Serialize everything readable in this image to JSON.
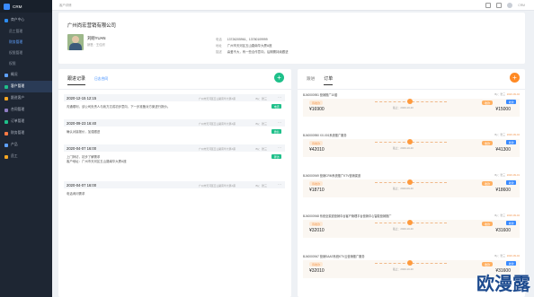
{
  "app": {
    "title": "CRM"
  },
  "sidebar": {
    "items": [
      {
        "label": "商户中心",
        "level": "main",
        "color": "#2d8cf0"
      },
      {
        "label": "员工管理",
        "level": "sub"
      },
      {
        "label": "财务管理",
        "level": "sub",
        "active_sub": true
      },
      {
        "label": "权限管理",
        "level": "sub"
      },
      {
        "label": "权限",
        "level": "sub"
      },
      {
        "label": "概况",
        "level": "main",
        "color": "#5fa1ff"
      },
      {
        "label": "客户管理",
        "level": "main",
        "color": "#1fc08a",
        "active": true
      },
      {
        "label": "跟进客户",
        "level": "main",
        "color": "#f5a623"
      },
      {
        "label": "合同管理",
        "level": "main",
        "color": "#8e7cc3"
      },
      {
        "label": "订单管理",
        "level": "main",
        "color": "#1fc08a"
      },
      {
        "label": "财务管理",
        "level": "main",
        "color": "#ff7a45"
      },
      {
        "label": "产品",
        "level": "main",
        "color": "#5fa1ff"
      },
      {
        "label": "员工",
        "level": "main",
        "color": "#f5a623"
      }
    ]
  },
  "topbar": {
    "breadcrumb": "客户详情",
    "user": "CRM"
  },
  "company": {
    "name": "广州尚宏营销有限公司",
    "person_name": "刘刚YUAN",
    "person_meta": "销售 · 王佳欣",
    "fields": [
      {
        "k": "电话",
        "v": "13726205961、13780109999"
      },
      {
        "k": "地址",
        "v": "广州市天河区五山路南华大厦A座"
      },
      {
        "k": "描述",
        "v": "喜爱不大，有一些合作意向，后期需持续跟进"
      }
    ]
  },
  "follow": {
    "tabs": [
      "跟进记录",
      "日志合同"
    ],
    "records": [
      {
        "time": "2020-12-15  12:15",
        "loc": "广州市天河区五山路南华大厦A座",
        "by": "By：张三",
        "text": "沟通顺利，该公司负责人与我方达成初步意向，下一步准备对方案进行报价。",
        "badge": "电话"
      },
      {
        "time": "2020-09-23  16:40",
        "loc": "广州市天河区五山路南华大厦A座",
        "by": "By：张三",
        "text": "确认对接报价，加强跟进",
        "badge": "微信"
      },
      {
        "time": "2020-04-07  16:00",
        "loc": "广州市天河区五山路南华大厦A座",
        "by": "By：张三",
        "text": "上门拜访，初步了解需求\n客户地址：广州市天河区五山路南华大厦A座",
        "badge": "拜访"
      },
      {
        "time": "2020-04-07  16:00",
        "loc": "广州市天河区五山路南华大厦A座",
        "by": "By：张三",
        "text": "电话询问需求",
        "badge": ""
      }
    ]
  },
  "orders": {
    "tabs": [
      "跟进",
      "订单"
    ],
    "rows": [
      {
        "no": "BJ40000951 营销推广10套",
        "by": "By：张三",
        "date": "2020-09-02",
        "pay_tag": "待收款",
        "price1": "¥16900",
        "cutoff": "截止：2020-10-20",
        "right_tag": "收款",
        "price2": "¥15000",
        "btn": "收款"
      },
      {
        "no": "BJ40000950 XX-001系统推广服务",
        "by": "By：张三",
        "date": "2020-09-02",
        "pay_tag": "待收款",
        "price1": "¥42010",
        "cutoff": "截止：2020-10-20",
        "right_tag": "收款",
        "price2": "¥41300",
        "btn": "收款"
      },
      {
        "no": "BJ40000949 营销CRM系统推广KTV营销渠道",
        "by": "By：张三",
        "date": "2020-09-01",
        "pay_tag": "待收款",
        "price1": "¥18710",
        "cutoff": "截止：2020-09-20",
        "right_tag": "收款",
        "price2": "¥18600",
        "btn": "收款"
      },
      {
        "no": "BJ40000948 系统全渠道营销中台客户管理平台营销中心智能营销推广",
        "by": "By：张三",
        "date": "2020-09-02",
        "pay_tag": "待收款",
        "price1": "¥32010",
        "cutoff": "截止：2020-10-20",
        "right_tag": "收款",
        "price2": "¥31600",
        "btn": "收款"
      },
      {
        "no": "BJ40000947 营销SAAS系统KTV云营销推广服务",
        "by": "By：张三",
        "date": "2020-09-02",
        "pay_tag": "待收款",
        "price1": "¥32010",
        "cutoff": "截止：2020-10-20",
        "right_tag": "收款",
        "price2": "¥31600",
        "btn": "收款"
      }
    ]
  },
  "watermark": "欧漫露"
}
